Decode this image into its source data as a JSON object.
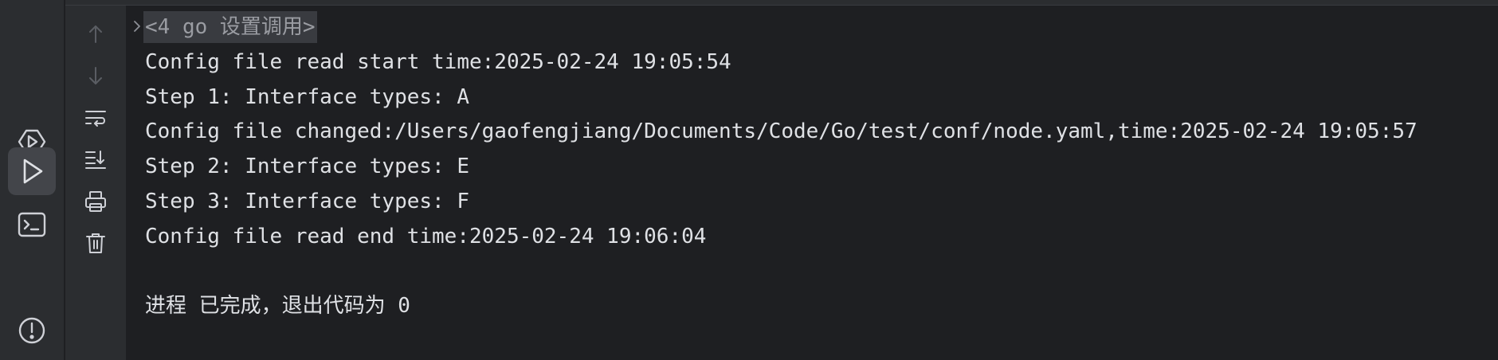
{
  "activity_bar": {
    "items": [
      {
        "icon": "debug-icon",
        "active": false
      },
      {
        "icon": "run-icon",
        "active": true
      },
      {
        "icon": "terminal-icon",
        "active": false
      },
      {
        "icon": "problems-icon",
        "active": false
      }
    ]
  },
  "toolbar": {
    "items": [
      {
        "icon": "arrow-up-icon",
        "enabled": false
      },
      {
        "icon": "arrow-down-icon",
        "enabled": false
      },
      {
        "icon": "soft-wrap-icon",
        "enabled": true
      },
      {
        "icon": "scroll-to-end-icon",
        "enabled": true
      },
      {
        "icon": "print-icon",
        "enabled": true
      },
      {
        "icon": "trash-icon",
        "enabled": true
      }
    ]
  },
  "console": {
    "header": "<4 go 设置调用>",
    "lines": [
      "Config file read start time:2025-02-24 19:05:54",
      "Step 1: Interface types: A",
      "Config file changed:/Users/gaofengjiang/Documents/Code/Go/test/conf/node.yaml,time:2025-02-24 19:05:57",
      "Step 2: Interface types: E",
      "Step 3: Interface types: F",
      "Config file read end time:2025-02-24 19:06:04"
    ],
    "exit_message": "进程 已完成，退出代码为 0"
  },
  "colors": {
    "background": "#1e1f22",
    "panel": "#2b2d30",
    "text": "#dfe1e5",
    "muted_icon": "#6f737a",
    "icon": "#ced0d6",
    "active_bg": "#43454a"
  }
}
